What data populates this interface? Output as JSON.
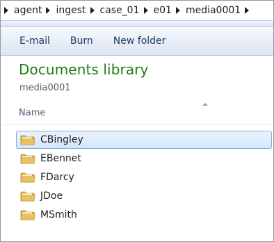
{
  "breadcrumb": [
    "agent",
    "ingest",
    "case_01",
    "e01",
    "media0001"
  ],
  "toolbar": {
    "email_label": "E-mail",
    "burn_label": "Burn",
    "new_folder_label": "New folder"
  },
  "library": {
    "title": "Documents library",
    "subtitle": "media0001"
  },
  "columns": {
    "name": "Name"
  },
  "folders": [
    {
      "label": "CBingley",
      "selected": true
    },
    {
      "label": "EBennet"
    },
    {
      "label": "FDarcy"
    },
    {
      "label": "JDoe"
    },
    {
      "label": "MSmith"
    }
  ],
  "colors": {
    "title_green": "#1e7d12",
    "selection_fill": "#d5e6fb",
    "selection_border": "#84acdd",
    "folder_yellow": "#e8c260"
  },
  "icons": {
    "folder": "folder-icon",
    "crumb_separator": "chevron-right-icon",
    "sort": "sort-ascending-icon"
  }
}
